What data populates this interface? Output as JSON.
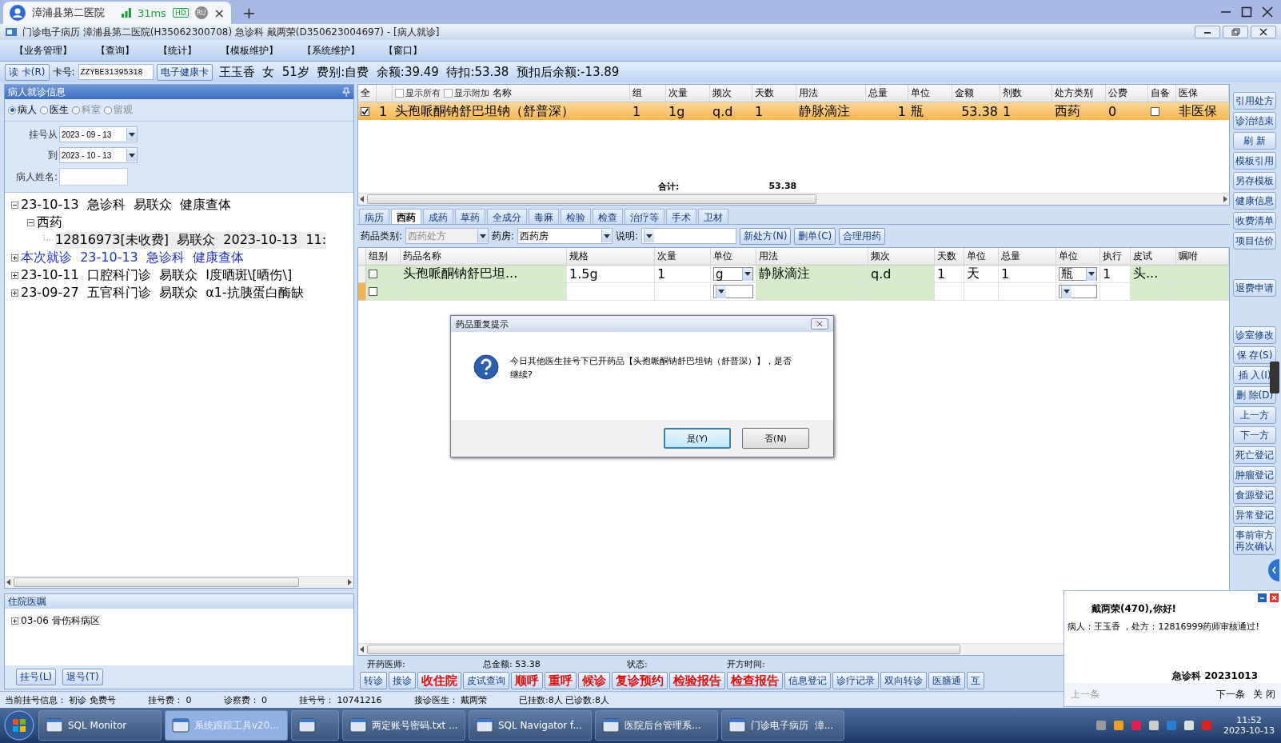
{
  "browser": {
    "tab_title": "漳浦县第二医院",
    "latency": "31ms",
    "hd_badge": "HD",
    "user_badge": "RU",
    "close_tab": "×",
    "new_tab": "+"
  },
  "window": {
    "title": "门诊电子病历  漳浦县第二医院(H35062300708)  急诊科  戴两荣(D350623004697) - [病人就诊]"
  },
  "menu": [
    "【业务管理】",
    "【查询】",
    "【统计】",
    "【模板维护】",
    "【系统维护】",
    "【窗口】"
  ],
  "patient_bar": {
    "read_card": "读 卡(R)",
    "card_label": "卡号:",
    "card_number": "ZZYBE31395318",
    "health_card": "电子健康卡",
    "info": "王玉香  女  51岁  费别:自费  余额:39.49  待扣:53.38  预扣后余额:-13.89"
  },
  "visit_panel": {
    "title": "病人就诊信息",
    "filters": [
      {
        "label": "病人",
        "selected": true,
        "disabled": false
      },
      {
        "label": "医生",
        "selected": false,
        "disabled": false
      },
      {
        "label": "科室",
        "selected": false,
        "disabled": true
      },
      {
        "label": "留观",
        "selected": false,
        "disabled": true
      }
    ],
    "date_from_label": "挂号从",
    "date_from": "2023 - 09 - 13",
    "date_to_label": "到",
    "date_to": "2023 - 10 - 13",
    "name_label": "病人姓名:",
    "tree": [
      {
        "text": "23-10-13  急诊科  易联众  健康查体",
        "expanded": true,
        "current": false,
        "selected": false,
        "children": [
          {
            "text": "西药",
            "expanded": true,
            "selected": false,
            "children": [
              {
                "text": "12816973[未收费]  易联众  2023-10-13  11:",
                "selected": true
              }
            ]
          }
        ]
      },
      {
        "text": "本次就诊  23-10-13  急诊科  健康查体",
        "expanded": false,
        "current": true,
        "selected": false
      },
      {
        "text": "23-10-11  口腔科门诊  易联众  Ⅰ度晒斑\\[晒伤\\]",
        "expanded": false,
        "current": false,
        "selected": false
      },
      {
        "text": "23-09-27  五官科门诊  易联众  α1-抗胰蛋白酶缺",
        "expanded": false,
        "current": false,
        "selected": false
      }
    ]
  },
  "inpatient_panel": {
    "title": "住院医嘱",
    "tree": [
      {
        "text": "03-06 骨伤科病区",
        "expanded": false,
        "selected": false
      }
    ],
    "buttons": [
      "挂号(L)",
      "退号(T)"
    ]
  },
  "prescription_table": {
    "columns": [
      {
        "label": "全"
      },
      {},
      {
        "label": "名称",
        "options": [
          {
            "label": "显示所有",
            "checked": false
          },
          {
            "label": "显示附加",
            "checked": false
          }
        ]
      },
      {
        "label": "组"
      },
      {
        "label": "次量"
      },
      {
        "label": "频次"
      },
      {
        "label": "天数"
      },
      {
        "label": "用法"
      },
      {
        "label": "总量"
      },
      {
        "label": "单位"
      },
      {
        "label": "金额"
      },
      {
        "label": "剂数"
      },
      {
        "label": "处方类别"
      },
      {
        "label": "公费"
      },
      {
        "label": "自备"
      },
      {
        "label": "医保"
      }
    ],
    "rows": [
      {
        "selected": true,
        "cells": [
          {
            "kind": "checkbox",
            "checked": true
          },
          {
            "kind": "text",
            "text": "1"
          },
          {
            "kind": "text",
            "text": "头孢哌酮钠舒巴坦钠（舒普深）"
          },
          {
            "kind": "text",
            "text": "1"
          },
          {
            "kind": "text",
            "text": "1g"
          },
          {
            "kind": "text",
            "text": "q.d"
          },
          {
            "kind": "text",
            "text": "1"
          },
          {
            "kind": "text",
            "text": "静脉滴注"
          },
          {
            "kind": "number",
            "text": "1"
          },
          {
            "kind": "text",
            "text": "瓶"
          },
          {
            "kind": "number",
            "text": "53.38"
          },
          {
            "kind": "text",
            "text": "1"
          },
          {
            "kind": "text",
            "text": "西药"
          },
          {
            "kind": "text",
            "text": "0"
          },
          {
            "kind": "checkbox",
            "checked": false
          },
          {
            "kind": "text",
            "text": "非医保"
          }
        ]
      }
    ],
    "total_label": "合计:",
    "total": "53.38"
  },
  "tabs": [
    {
      "label": "病历",
      "selected": false
    },
    {
      "label": "西药",
      "selected": true
    },
    {
      "label": "成药",
      "selected": false
    },
    {
      "label": "草药",
      "selected": false
    },
    {
      "label": "全成分",
      "selected": false
    },
    {
      "label": "毒麻",
      "selected": false
    },
    {
      "label": "检验",
      "selected": false
    },
    {
      "label": "检查",
      "selected": false
    },
    {
      "label": "治疗等",
      "selected": false
    },
    {
      "label": "手术",
      "selected": false
    },
    {
      "label": "卫材",
      "selected": false
    }
  ],
  "toolbar": {
    "category_label": "药品类别:",
    "category": "西药处方",
    "category_disabled": true,
    "pharmacy_label": "药房:",
    "pharmacy": "西药房",
    "note_label": "说明:",
    "buttons": [
      "新处方(N)",
      "删单(C)",
      "合理用药"
    ]
  },
  "drug_table": {
    "columns": [
      {
        "label": "组别",
        "editable": false
      },
      {
        "label": "药品名称",
        "editable": false
      },
      {
        "label": "规格",
        "editable": true
      },
      {
        "label": "次量",
        "editable": true
      },
      {
        "label": "单位",
        "editable": true
      },
      {
        "label": "用法",
        "editable": false
      },
      {
        "label": "频次",
        "editable": false
      },
      {
        "label": "天数",
        "editable": true
      },
      {
        "label": "单位",
        "editable": true
      },
      {
        "label": "总量",
        "editable": true
      },
      {
        "label": "单位",
        "editable": true
      },
      {
        "label": "执行",
        "editable": true
      },
      {
        "label": "皮试",
        "editable": false
      },
      {
        "label": "嘱咐",
        "editable": false
      }
    ],
    "rows": [
      {
        "current": false,
        "cells": [
          {
            "kind": "checkbox",
            "checked": false
          },
          {
            "kind": "text",
            "text": "头孢哌酮钠舒巴坦..."
          },
          {
            "kind": "text",
            "text": "1.5g"
          },
          {
            "kind": "text",
            "text": "1"
          },
          {
            "kind": "dropdown",
            "text": "g"
          },
          {
            "kind": "text",
            "text": "静脉滴注"
          },
          {
            "kind": "text",
            "text": "q.d"
          },
          {
            "kind": "text",
            "text": "1"
          },
          {
            "kind": "text",
            "text": "天"
          },
          {
            "kind": "text",
            "text": "1"
          },
          {
            "kind": "dropdown",
            "text": "瓶"
          },
          {
            "kind": "text",
            "text": "1"
          },
          {
            "kind": "text",
            "text": "头..."
          },
          {
            "kind": "blank"
          }
        ]
      },
      {
        "current": true,
        "cells": [
          {
            "kind": "checkbox",
            "checked": false
          },
          {
            "kind": "blank"
          },
          {
            "kind": "blank"
          },
          {
            "kind": "blank"
          },
          {
            "kind": "dropdown"
          },
          {
            "kind": "blank"
          },
          {
            "kind": "blank"
          },
          {
            "kind": "blank"
          },
          {
            "kind": "blank"
          },
          {
            "kind": "blank"
          },
          {
            "kind": "dropdown"
          },
          {
            "kind": "blank"
          },
          {
            "kind": "blank"
          },
          {
            "kind": "blank"
          }
        ]
      }
    ]
  },
  "footer_info": [
    "开药医师:",
    "总金额: 53.38",
    "状态:",
    "开方时间:"
  ],
  "action_buttons": [
    {
      "label": "转诊",
      "kind": "normal"
    },
    {
      "label": "接诊",
      "kind": "normal"
    },
    {
      "label": "收住院",
      "kind": "alert"
    },
    {
      "label": "皮试查询",
      "kind": "normal"
    },
    {
      "label": "顺呼",
      "kind": "alert"
    },
    {
      "label": "重呼",
      "kind": "alert"
    },
    {
      "label": "候诊",
      "kind": "alert"
    },
    {
      "label": "复诊预约",
      "kind": "alert"
    },
    {
      "label": "检验报告",
      "kind": "alert"
    },
    {
      "label": "检查报告",
      "kind": "alert"
    },
    {
      "label": "信息登记",
      "kind": "normal"
    },
    {
      "label": "诊疗记录",
      "kind": "normal"
    },
    {
      "label": "双向转诊",
      "kind": "normal"
    },
    {
      "label": "医膳通",
      "kind": "normal"
    },
    {
      "label": "互",
      "kind": "normal"
    }
  ],
  "right_toolbar": [
    [
      "引用处方",
      "诊治结束",
      "刷 新",
      "模板引用",
      "另存模板",
      "健康信息",
      "收费清单",
      "项目估价"
    ],
    [
      "退费申请"
    ],
    [
      "诊室修改",
      "保 存(S)",
      "插 入(I)",
      "删 除(D)",
      "上一方",
      "下一方",
      "死亡登记",
      "肿瘤登记",
      "食源登记",
      "异常登记",
      "事前审方再次确认"
    ]
  ],
  "status_bar": [
    "当前挂号信息： 初诊 免费号",
    "挂号费： 0",
    "诊察费： 0",
    "挂号号： 10741216",
    "接诊医生： 戴两荣",
    "已挂数:8人 已诊数:8人"
  ],
  "dialog": {
    "title": "药品重复提示",
    "message": "今日其他医生挂号下已开药品【头孢哌酮钠舒巴坦钠（舒普深）】，是否继续?",
    "buttons": [
      {
        "label": "是(Y)",
        "selected": true
      },
      {
        "label": "否(N)",
        "selected": false
      }
    ]
  },
  "notification": {
    "greeting": "戴两荣(470),你好!",
    "message": "病人：王玉香 ，处方：12816999药师审核通过!",
    "footer": "急诊科  20231013",
    "links": [
      {
        "label": "上一条",
        "disabled": true
      },
      {
        "label": "下一条",
        "disabled": false
      },
      {
        "label": "关 闭",
        "disabled": false
      }
    ]
  },
  "taskbar": {
    "items": [
      {
        "label": "SQL Monitor",
        "active": false
      },
      {
        "label": "系统跟踪工具v20...",
        "active": true
      },
      {
        "active": false
      },
      {
        "label": "两定账号密码.txt ...",
        "active": false
      },
      {
        "label": "SQL Navigator f...",
        "active": false
      },
      {
        "label": "医院后台管理系...",
        "active": false
      },
      {
        "label": "门诊电子病历  漳...",
        "active": false
      }
    ],
    "time": "11:52",
    "date": "2023-10-13"
  }
}
